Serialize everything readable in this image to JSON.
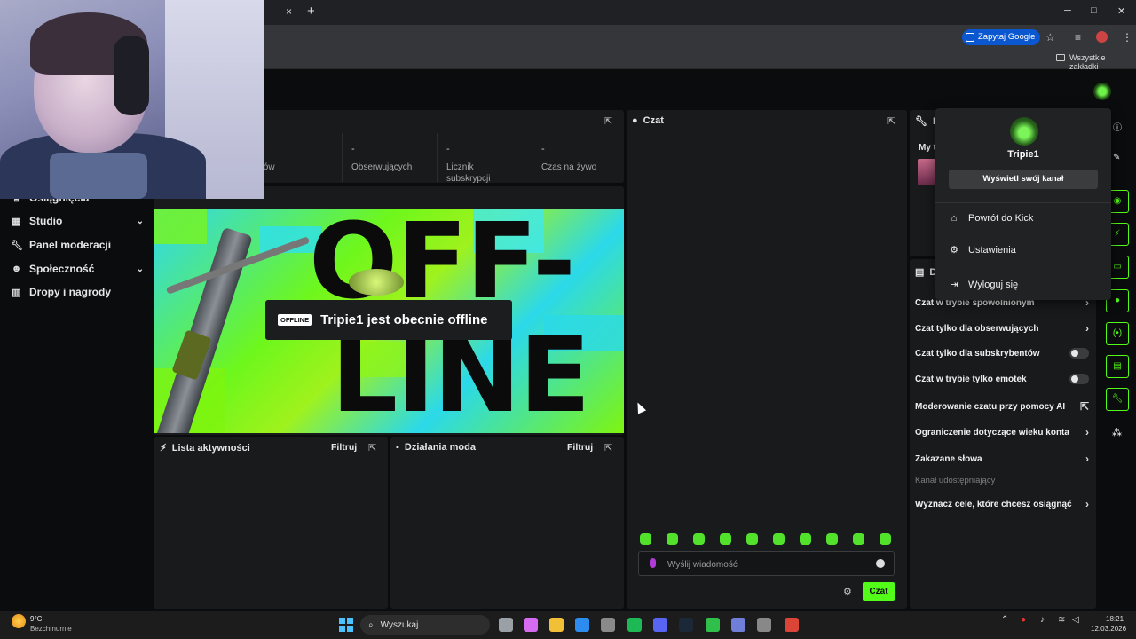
{
  "browser": {
    "gemini_button": "Zapytaj Google",
    "bookmarks_label": "Wszystkie zakładki",
    "tab_close": "×",
    "tab_new": "+",
    "minimize": "─",
    "maximize": "□",
    "close": "✕"
  },
  "sidebar": {
    "items": [
      {
        "label": "Osiągnięcia",
        "icon": "trophy-icon",
        "chevron": false
      },
      {
        "label": "Studio",
        "icon": "studio-icon",
        "chevron": true
      },
      {
        "label": "Panel moderacji",
        "icon": "wrench-icon",
        "chevron": false
      },
      {
        "label": "Społeczność",
        "icon": "people-icon",
        "chevron": true
      },
      {
        "label": "Dropy i nagrody",
        "icon": "gift-icon",
        "chevron": false
      }
    ]
  },
  "stats": {
    "col1_label": "idzów",
    "followers": {
      "value": "-",
      "label": "Obserwujących"
    },
    "subs": {
      "value": "-",
      "label": "Licznik subskrypcji"
    },
    "live": {
      "value": "-",
      "label": "Czas na żywo"
    }
  },
  "offline": {
    "badge": "OFFLINE",
    "message": "Tripie1 jest obecnie offline",
    "banner_line1": "OFF-",
    "banner_line2": "LINE"
  },
  "activity": {
    "title": "Lista aktywności",
    "filter": "Filtruj"
  },
  "modactions": {
    "title": "Działania moda",
    "filter": "Filtruj"
  },
  "chat": {
    "title": "Czat",
    "placeholder": "Wyślij wiadomość",
    "send": "Czat"
  },
  "info_panel": {
    "title_fragment": "In",
    "sub_fragment": "My t"
  },
  "settings_panel": {
    "title_fragment": "Dz",
    "rows": [
      {
        "label": "Czat w trybie spowolnionym",
        "control": "arrow"
      },
      {
        "label": "Czat tylko dla obserwujących",
        "control": "arrow"
      },
      {
        "label": "Czat tylko dla subskrybentów",
        "control": "toggle",
        "enabled": false
      },
      {
        "label": "Czat w trybie tylko emotek",
        "control": "toggle",
        "enabled": false
      },
      {
        "label": "Moderowanie czatu przy pomocy AI",
        "control": "external"
      },
      {
        "label": "Ograniczenie dotyczące wieku konta",
        "control": "arrow"
      },
      {
        "label": "Zakazane słowa",
        "control": "arrow"
      }
    ],
    "shared_channel": "Kanał udostępniający",
    "goals": "Wyznacz cele, które chcesz osiągnąć"
  },
  "dropdown": {
    "username": "Tripie1",
    "view_channel": "Wyświetl swój kanał",
    "items": [
      {
        "label": "Powrót do Kick",
        "icon": "home-icon"
      },
      {
        "label": "Ustawienia",
        "icon": "gear-icon"
      },
      {
        "label": "Wyloguj się",
        "icon": "logout-icon"
      }
    ]
  },
  "taskbar": {
    "weather_temp": "9°C",
    "weather_desc": "Bezchmurnie",
    "search": "Wyszukaj",
    "time": "18:21",
    "date": "12.03.2026"
  },
  "colors": {
    "accent": "#53fc18",
    "panel": "#181a1b",
    "background": "#0b0c0d"
  }
}
